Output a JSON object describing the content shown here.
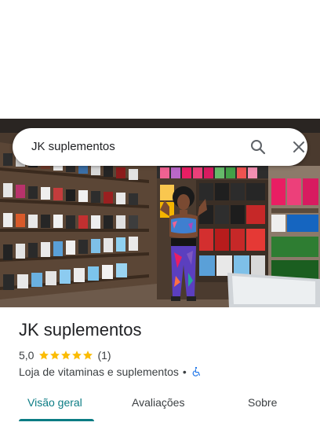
{
  "search": {
    "query": "JK suplementos"
  },
  "place": {
    "name": "JK suplementos",
    "rating": "5,0",
    "stars": 5,
    "review_count": "(1)",
    "category": "Loja de vitaminas e suplementos",
    "separator": "•"
  },
  "tabs": [
    {
      "label": "Visão geral",
      "active": true
    },
    {
      "label": "Avaliações",
      "active": false
    },
    {
      "label": "Sobre",
      "active": false
    }
  ],
  "colors": {
    "accent": "#0b7c84",
    "star": "#fbbc04",
    "accessibility": "#1a73e8"
  },
  "icons": {
    "search": "search-icon",
    "close": "close-icon",
    "accessibility": "wheelchair-accessible-icon"
  }
}
